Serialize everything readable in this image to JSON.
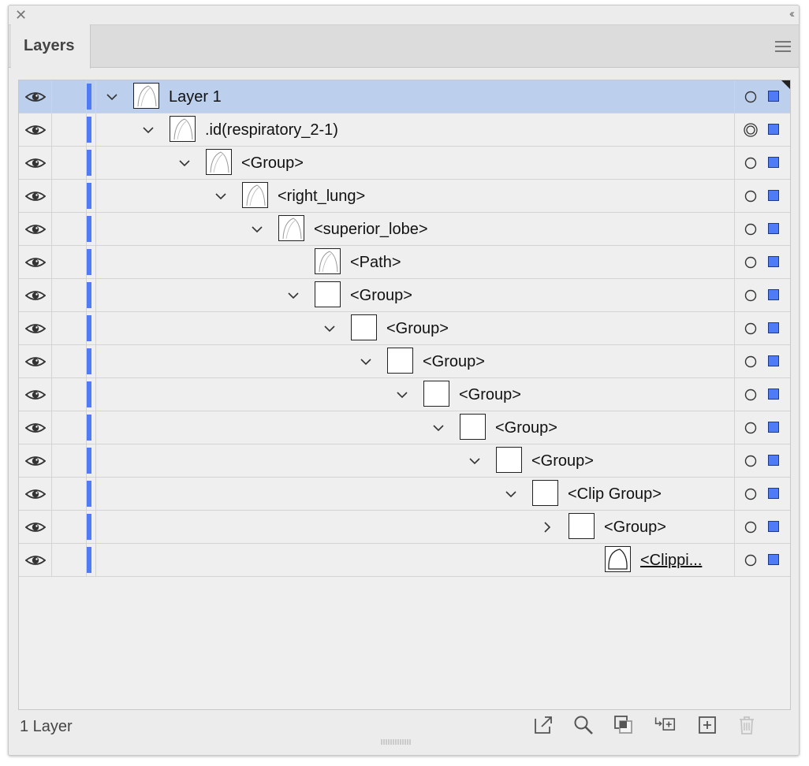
{
  "panel": {
    "tab_label": "Layers",
    "footer_count": "1 Layer",
    "accent_color": "#4f7cf6",
    "selected_row_color": "#bccfec"
  },
  "layers": [
    {
      "name": "Layer 1",
      "depth": 0,
      "expander": "expanded",
      "thumb": "art",
      "selected": true,
      "target": "circle",
      "underlined": false
    },
    {
      "name": ".id(respiratory_2-1)",
      "depth": 1,
      "expander": "expanded",
      "thumb": "art",
      "selected": false,
      "target": "double-circle",
      "underlined": false
    },
    {
      "name": "<Group>",
      "depth": 2,
      "expander": "expanded",
      "thumb": "art",
      "selected": false,
      "target": "circle",
      "underlined": false
    },
    {
      "name": "<right_lung>",
      "depth": 3,
      "expander": "expanded",
      "thumb": "art",
      "selected": false,
      "target": "circle",
      "underlined": false
    },
    {
      "name": "<superior_lobe>",
      "depth": 4,
      "expander": "expanded",
      "thumb": "art",
      "selected": false,
      "target": "circle",
      "underlined": false
    },
    {
      "name": "<Path>",
      "depth": 5,
      "expander": "none",
      "thumb": "art",
      "selected": false,
      "target": "circle",
      "underlined": false
    },
    {
      "name": "<Group>",
      "depth": 5,
      "expander": "expanded",
      "thumb": "blank",
      "selected": false,
      "target": "circle",
      "underlined": false
    },
    {
      "name": "<Group>",
      "depth": 6,
      "expander": "expanded",
      "thumb": "blank",
      "selected": false,
      "target": "circle",
      "underlined": false
    },
    {
      "name": "<Group>",
      "depth": 7,
      "expander": "expanded",
      "thumb": "blank",
      "selected": false,
      "target": "circle",
      "underlined": false
    },
    {
      "name": "<Group>",
      "depth": 8,
      "expander": "expanded",
      "thumb": "blank",
      "selected": false,
      "target": "circle",
      "underlined": false
    },
    {
      "name": "<Group>",
      "depth": 9,
      "expander": "expanded",
      "thumb": "blank",
      "selected": false,
      "target": "circle",
      "underlined": false
    },
    {
      "name": "<Group>",
      "depth": 10,
      "expander": "expanded",
      "thumb": "blank",
      "selected": false,
      "target": "circle",
      "underlined": false
    },
    {
      "name": "<Clip Group>",
      "depth": 11,
      "expander": "expanded",
      "thumb": "blank",
      "selected": false,
      "target": "circle",
      "underlined": false
    },
    {
      "name": "<Group>",
      "depth": 12,
      "expander": "collapsed",
      "thumb": "blank",
      "selected": false,
      "target": "circle",
      "underlined": false
    },
    {
      "name": "<Clippi...",
      "depth": 13,
      "expander": "none",
      "thumb": "shape",
      "selected": false,
      "target": "circle",
      "underlined": true
    }
  ],
  "footer_icons": [
    "export-icon",
    "locate-object-icon",
    "make-clipping-mask-icon",
    "create-sublayer-icon",
    "create-new-layer-icon",
    "delete-layer-icon"
  ]
}
